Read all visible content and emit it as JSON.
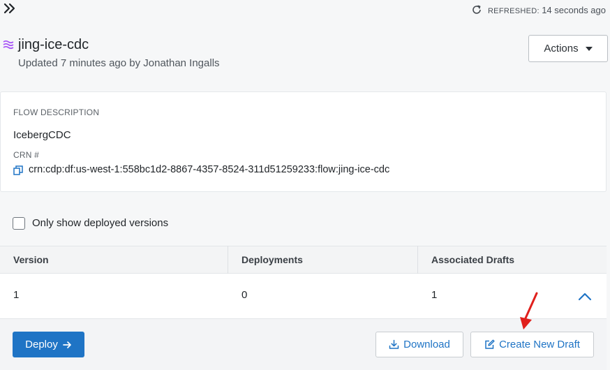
{
  "header": {
    "refresh_label": "REFRESHED:",
    "refresh_value": "14 seconds ago"
  },
  "flow": {
    "name": "jing-ice-cdc",
    "updated": "Updated 7 minutes ago by Jonathan Ingalls",
    "actions_label": "Actions"
  },
  "details": {
    "description_label": "FLOW DESCRIPTION",
    "description_value": "IcebergCDC",
    "crn_label": "CRN #",
    "crn_value": "crn:cdp:df:us-west-1:558bc1d2-8867-4357-8524-311d51259233:flow:jing-ice-cdc"
  },
  "filter": {
    "only_deployed_label": "Only show deployed versions",
    "checked": false
  },
  "table": {
    "columns": [
      "Version",
      "Deployments",
      "Associated Drafts"
    ],
    "rows": [
      [
        "1",
        "0",
        "1"
      ]
    ]
  },
  "buttons": {
    "deploy": "Deploy",
    "download": "Download",
    "create_draft": "Create New Draft"
  },
  "colors": {
    "primary": "#1f74c5",
    "flow_icon": "#a855f7",
    "annotation_arrow": "#e0201c"
  },
  "icons": [
    "double-chevron-right-icon",
    "refresh-icon",
    "flow-icon",
    "copy-icon",
    "arrow-right-icon",
    "download-icon",
    "edit-icon",
    "chevron-up-icon"
  ]
}
